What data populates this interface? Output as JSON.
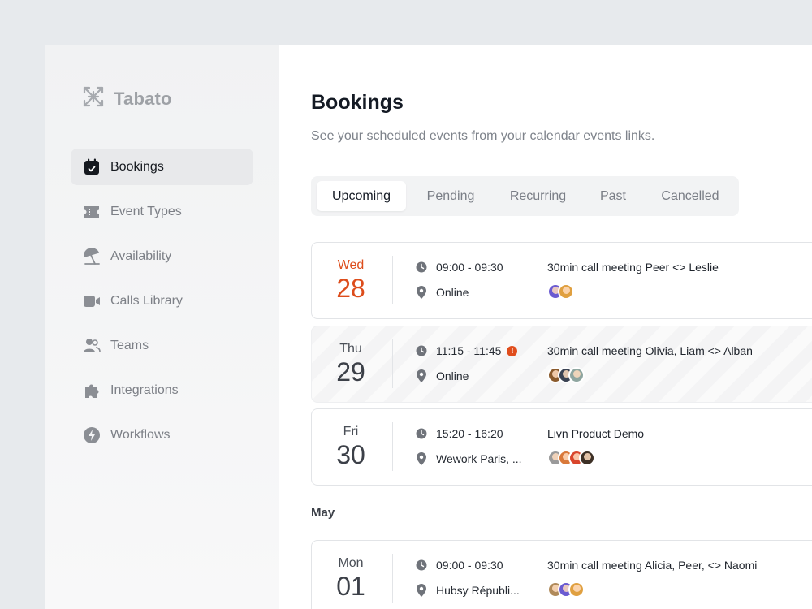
{
  "brand": {
    "name": "Tabato"
  },
  "sidebar": {
    "items": [
      {
        "label": "Bookings",
        "icon": "calendar-check-icon",
        "active": true
      },
      {
        "label": "Event Types",
        "icon": "ticket-icon",
        "active": false
      },
      {
        "label": "Availability",
        "icon": "beach-umbrella-icon",
        "active": false
      },
      {
        "label": "Calls Library",
        "icon": "video-camera-icon",
        "active": false
      },
      {
        "label": "Teams",
        "icon": "users-icon",
        "active": false
      },
      {
        "label": "Integrations",
        "icon": "puzzle-icon",
        "active": false
      },
      {
        "label": "Workflows",
        "icon": "lightning-icon",
        "active": false
      }
    ]
  },
  "main": {
    "title": "Bookings",
    "subtitle": "See your scheduled events from your calendar events links.",
    "tabs": [
      {
        "label": "Upcoming",
        "active": true
      },
      {
        "label": "Pending",
        "active": false
      },
      {
        "label": "Recurring",
        "active": false
      },
      {
        "label": "Past",
        "active": false
      },
      {
        "label": "Cancelled",
        "active": false
      }
    ],
    "bookings": [
      {
        "dow": "Wed",
        "day": "28",
        "time": "09:00 - 09:30",
        "location": "Online",
        "title": "30min call meeting Peer <> Leslie",
        "today": true
      },
      {
        "dow": "Thu",
        "day": "29",
        "time": "11:15 - 11:45",
        "location": "Online",
        "title": "30min call meeting Olivia, Liam <> Alban",
        "warning": true
      },
      {
        "dow": "Fri",
        "day": "30",
        "time": "15:20 - 16:20",
        "location": "Wework Paris, ...",
        "title": "Livn Product Demo"
      },
      {
        "dow": "Mon",
        "day": "01",
        "time": "09:00 - 09:30",
        "location": "Hubsy Républi...",
        "title": "30min call meeting Alicia, Peer, <> Naomi"
      }
    ],
    "section_may": "May"
  },
  "colors": {
    "accent": "#dd4d1c",
    "warning": "#e04d1c",
    "active_nav_bg": "#e8e9eb"
  }
}
